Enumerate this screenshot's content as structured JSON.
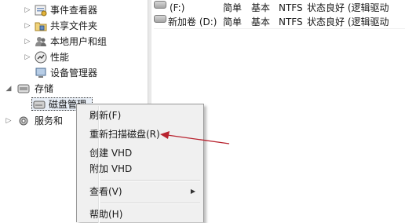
{
  "tree": {
    "items": [
      {
        "label": "事件查看器",
        "icon": "event-viewer-icon",
        "arrow": "▷"
      },
      {
        "label": "共享文件夹",
        "icon": "shared-folder-icon",
        "arrow": "▷"
      },
      {
        "label": "本地用户和组",
        "icon": "users-icon",
        "arrow": "▷"
      },
      {
        "label": "性能",
        "icon": "performance-icon",
        "arrow": "▷"
      },
      {
        "label": "设备管理器",
        "icon": "device-manager-icon",
        "arrow": ""
      },
      {
        "label": "存储",
        "icon": "storage-icon",
        "arrow": "◢"
      },
      {
        "label": "磁盘管理",
        "icon": "disk-management-icon",
        "arrow": ""
      },
      {
        "label": "服务和",
        "icon": "services-icon",
        "arrow": "▷"
      }
    ]
  },
  "volumes": [
    {
      "name": "(F:)",
      "layout": "简单",
      "type": "基本",
      "fs": "NTFS",
      "status": "状态良好 (逻辑驱动"
    },
    {
      "name": "新加卷 (D:)",
      "layout": "简单",
      "type": "基本",
      "fs": "NTFS",
      "status": "状态良好 (逻辑驱动"
    }
  ],
  "context_menu": {
    "items": [
      {
        "label": "刷新(F)"
      },
      {
        "label": "重新扫描磁盘(R)"
      },
      {
        "label": "创建 VHD"
      },
      {
        "label": "附加 VHD"
      },
      {
        "label": "查看(V)",
        "submenu_arrow": "▶"
      },
      {
        "label": "帮助(H)"
      }
    ]
  },
  "colors": {
    "annotation_arrow": "#b8232f",
    "selection_border": "#333333",
    "menu_background": "#f0f0f0"
  }
}
